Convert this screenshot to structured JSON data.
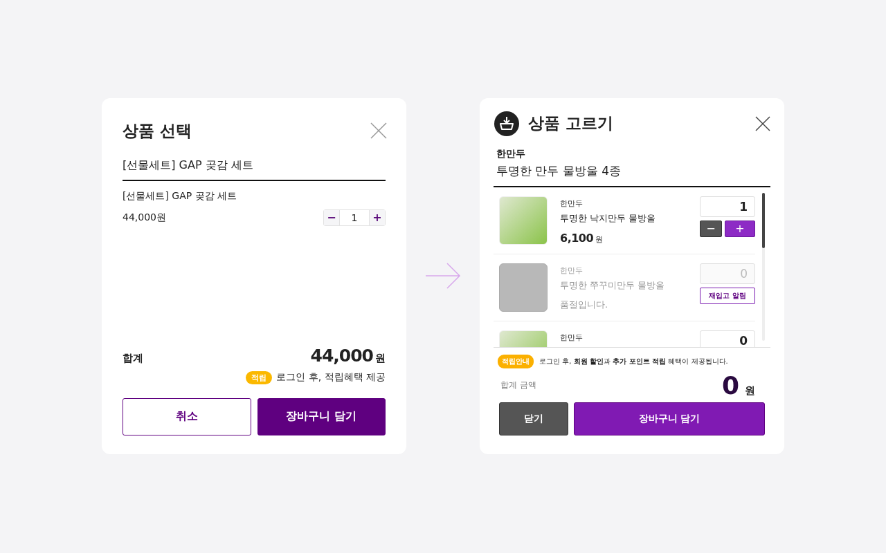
{
  "select_panel": {
    "title": "상품 선택",
    "product": "[선물세트] GAP 곶감 세트",
    "option": {
      "name": "[선물세트] GAP 곶감 세트",
      "price": "44,000원",
      "quantity": "1",
      "minus": "−",
      "plus": "+"
    },
    "total": {
      "label": "합계",
      "amount": "44,000",
      "unit": "원"
    },
    "point": {
      "badge": "적립",
      "text": "로그인 후, 적립혜택 제공"
    },
    "buttons": [
      {
        "label": "취소",
        "kind": "outline"
      },
      {
        "label": "장바구니 담기",
        "kind": "primary"
      }
    ]
  },
  "picker_panel": {
    "title": "상품 고르기",
    "brand": "한만두",
    "product": "투명한 만두 물방울 4종",
    "items": [
      {
        "brand": "한만두",
        "name": "투명한 낙지만두 물방울",
        "price": "6,100",
        "unit": "원",
        "quantity": "1",
        "sold_out": false,
        "minus": "−",
        "plus": "+"
      },
      {
        "brand": "한만두",
        "name": "투명한 쭈꾸미만두 물방울",
        "status": "품절입니다.",
        "quantity": "0",
        "sold_out": true,
        "action": "재입고 알림"
      },
      {
        "brand": "한만두",
        "quantity": "0",
        "sold_out": false
      }
    ],
    "notice": {
      "badge": "적립안내",
      "text": "로그인 후, **회원 할인**과 **추가 포인트 적립** 혜택이 제공됩니다."
    },
    "total": {
      "label": "합계 금액",
      "amount": "0",
      "unit": "원"
    },
    "buttons": [
      {
        "label": "닫기",
        "kind": "dark"
      },
      {
        "label": "장바구니 담기",
        "kind": "primary"
      }
    ]
  }
}
